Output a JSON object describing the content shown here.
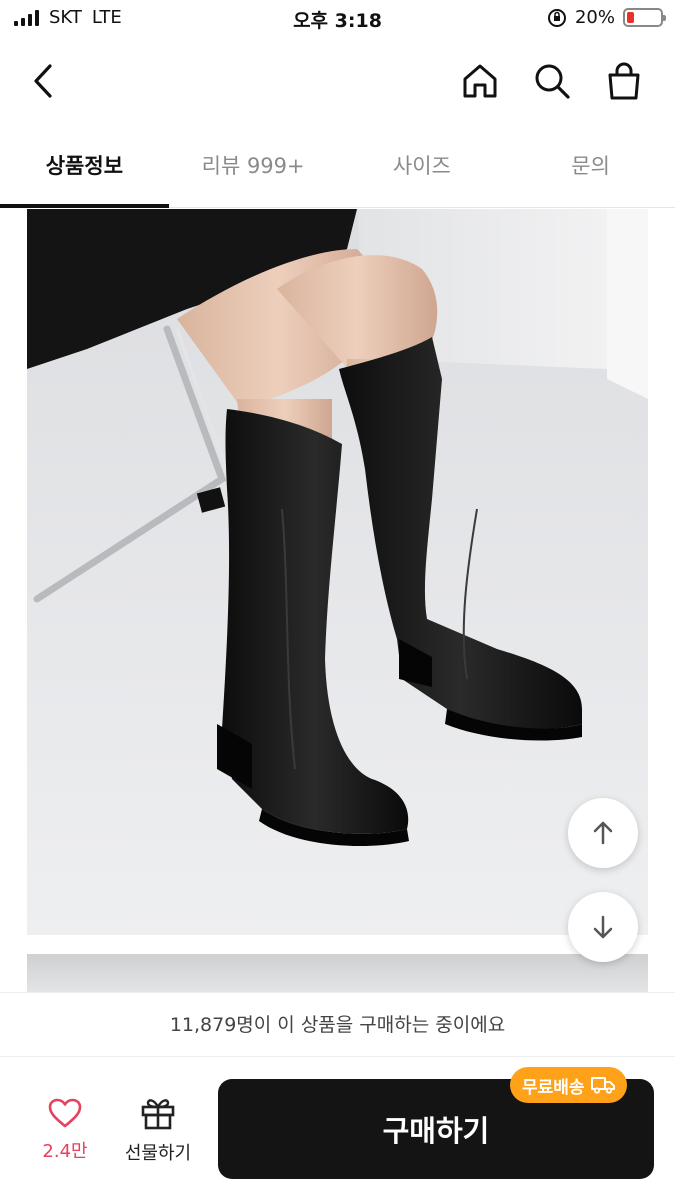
{
  "status_bar": {
    "carrier": "SKT",
    "network": "LTE",
    "time": "오후 3:18",
    "battery": "20%",
    "battery_level": 0.2
  },
  "header": {
    "icons": [
      "back-icon",
      "home-icon",
      "search-icon",
      "shopping-bag-icon"
    ]
  },
  "tabs": [
    {
      "label": "상품정보",
      "active": true
    },
    {
      "label": "리뷰 999+",
      "active": false
    },
    {
      "label": "사이즈",
      "active": false
    },
    {
      "label": "문의",
      "active": false
    }
  ],
  "product": {
    "image": "black-knee-high-boots-photo"
  },
  "notice": "11,879명이 이 상품을 구매하는 중이에요",
  "bottom_bar": {
    "like_count": "2.4만",
    "gift_label": "선물하기",
    "buy_label": "구매하기",
    "free_shipping_badge": "무료배송"
  },
  "colors": {
    "accent_like": "#e6415d",
    "buy_button": "#141414",
    "badge": "#ffa21a",
    "battery": "#e8312b"
  }
}
